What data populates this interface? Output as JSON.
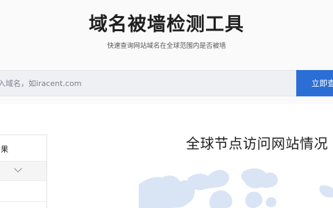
{
  "page": {
    "title": "域名被墙检测工具",
    "subtitle": "快速查询网站域名在全球范围内是否被墙"
  },
  "search": {
    "placeholder": "入域名，如iracent.com",
    "button_label": "立即查"
  },
  "results": {
    "label": "果"
  },
  "map": {
    "title": "全球节点访问网站情况"
  },
  "colors": {
    "accent": "#2b6fd6",
    "map_land": "#d9e4f5"
  },
  "icons": {
    "region_select": "chevron-down-icon"
  }
}
